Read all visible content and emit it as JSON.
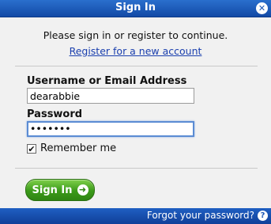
{
  "window": {
    "title": "Sign In"
  },
  "intro": {
    "prompt": "Please sign in or register to continue.",
    "register_link": "Register for a new account"
  },
  "form": {
    "username_label": "Username or Email Address",
    "username_value": "dearabbie",
    "password_label": "Password",
    "password_value": "•••••••",
    "remember_label": "Remember me",
    "remember_checked": true
  },
  "actions": {
    "signin_label": "Sign In"
  },
  "footer": {
    "forgot_label": "Forgot your password?"
  },
  "icons": {
    "close": "close-icon",
    "arrow": "arrow-right-icon",
    "help": "help-icon",
    "check": "check-icon"
  },
  "colors": {
    "titlebar": "#1c56b5",
    "link": "#1a3fae",
    "button_green": "#3b9a1a"
  }
}
